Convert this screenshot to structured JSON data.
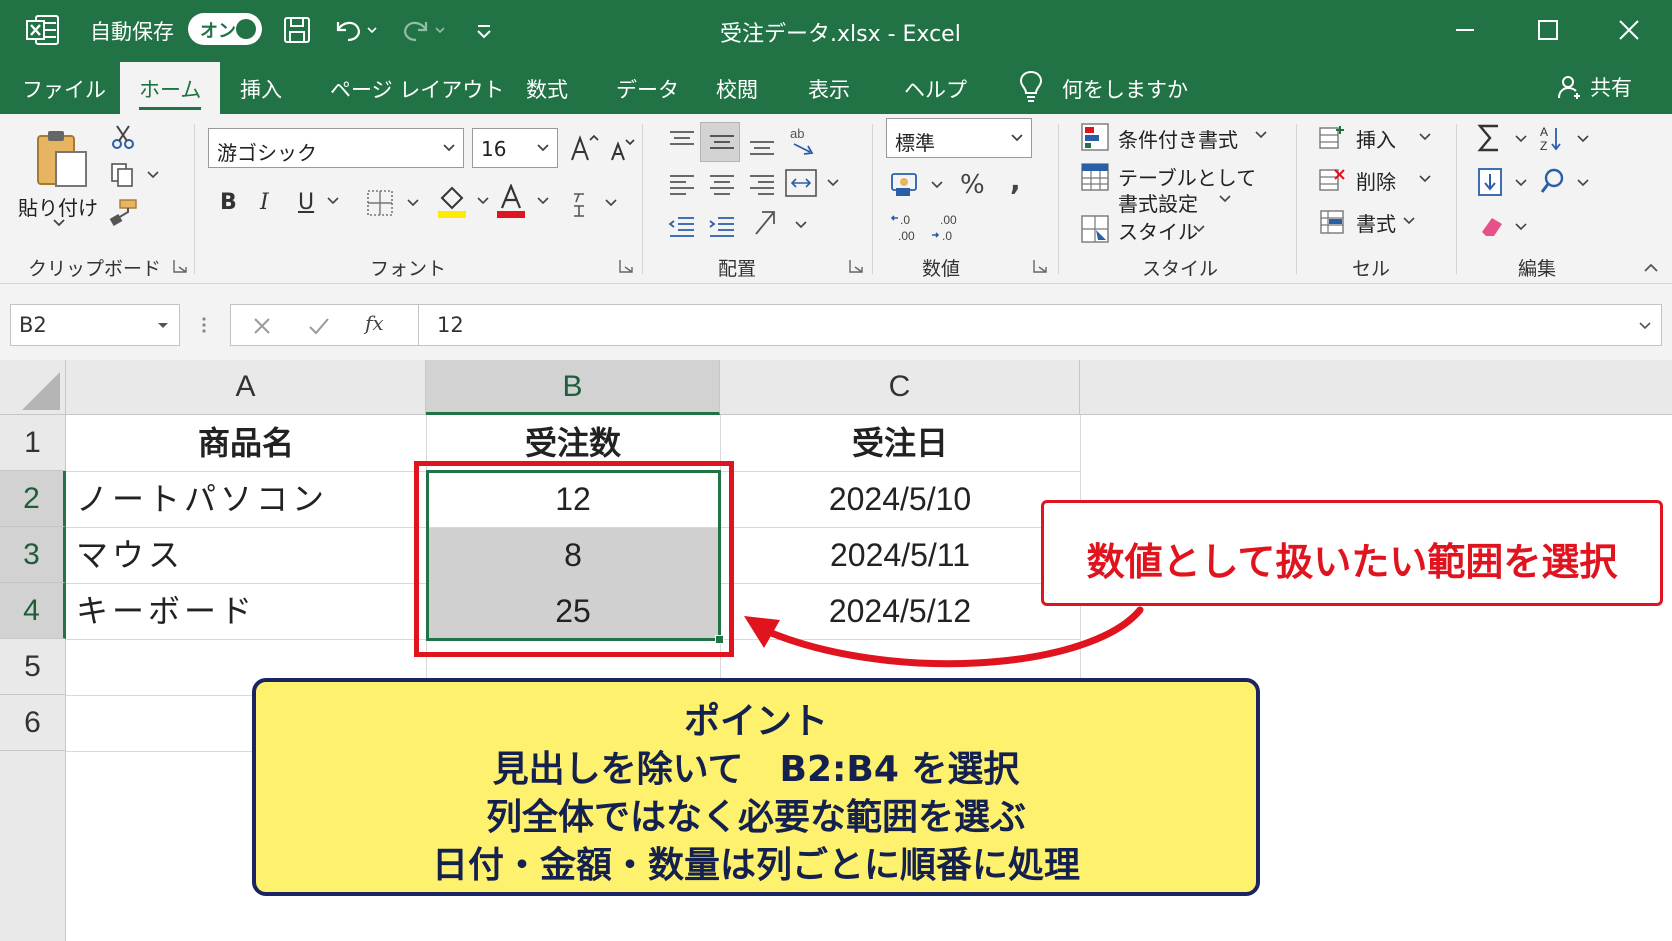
{
  "titlebar": {
    "autosave_label": "自動保存",
    "autosave_state": "オン",
    "document_title": "受注データ.xlsx  -  Excel"
  },
  "tabs": [
    {
      "label": "ファイル"
    },
    {
      "label": "ホーム",
      "active": true
    },
    {
      "label": "挿入"
    },
    {
      "label": "ページ レイアウト"
    },
    {
      "label": "数式"
    },
    {
      "label": "データ"
    },
    {
      "label": "校閲"
    },
    {
      "label": "表示"
    },
    {
      "label": "ヘルプ"
    },
    {
      "label": "何をしますか"
    }
  ],
  "share_label": "共有",
  "ribbon": {
    "clipboard": {
      "paste_label": "貼り付け",
      "group_label": "クリップボード"
    },
    "font": {
      "font_name": "游ゴシック",
      "font_size": "16",
      "bold": "B",
      "italic": "I",
      "underline": "U",
      "group_label": "フォント"
    },
    "alignment": {
      "group_label": "配置"
    },
    "number": {
      "format": "標準",
      "percent": "%",
      "comma": ",",
      "group_label": "数値"
    },
    "styles": {
      "conditional": "条件付き書式",
      "as_table_line1": "テーブルとして",
      "as_table_line2": "書式設定",
      "cell_styles": "スタイル",
      "group_label": "スタイル"
    },
    "cells": {
      "insert": "挿入",
      "delete": "削除",
      "format": "書式",
      "group_label": "セル"
    },
    "editing": {
      "group_label": "編集"
    }
  },
  "formula_bar": {
    "name_box": "B2",
    "fx": "fx",
    "value": "12"
  },
  "sheet": {
    "columns": [
      "A",
      "B",
      "C"
    ],
    "rows": [
      "1",
      "2",
      "3",
      "4",
      "5",
      "6"
    ],
    "header": {
      "a": "商品名",
      "b": "受注数",
      "c": "受注日"
    },
    "data": [
      {
        "a": "ノートパソコン",
        "b": "12",
        "c": "2024/5/10"
      },
      {
        "a": "マウス",
        "b": "8",
        "c": "2024/5/11"
      },
      {
        "a": "キーボード",
        "b": "25",
        "c": "2024/5/12"
      }
    ]
  },
  "annotations": {
    "callout": "数値として扱いたい範囲を選択",
    "point_lines": [
      "ポイント",
      "見出しを除いて　B2:B4 を選択",
      "列全体ではなく必要な範囲を選ぶ",
      "日付・金額・数量は列ごとに順番に処理"
    ]
  },
  "colors": {
    "excel_green": "#217346",
    "callout_red": "#e0141f",
    "point_yellow": "#fdf16d",
    "point_navy": "#1b2462"
  }
}
